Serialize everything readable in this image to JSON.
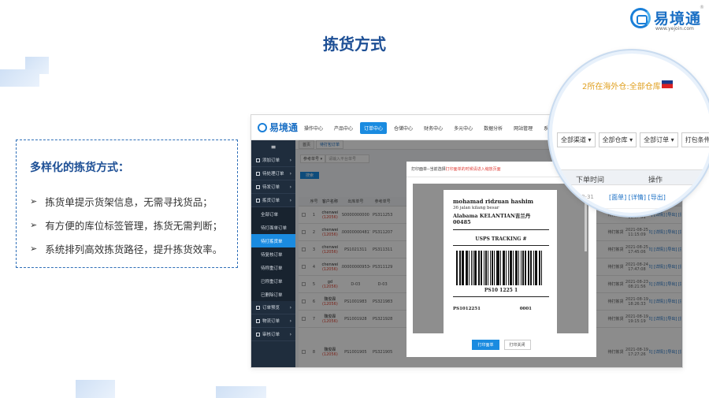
{
  "brand": {
    "name": "易境通",
    "url": "www.yejoin.com",
    "reg": "®"
  },
  "title": "拣货方式",
  "feature": {
    "heading": "多样化的拣货方式：",
    "items": [
      "拣货单提示货架信息，无需寻找货品；",
      "有方便的库位标签管理，拣货无需判断；",
      "系统排列高效拣货路径，提升拣货效率。"
    ],
    "bullet": "➢"
  },
  "app": {
    "logo": "易境通",
    "nav": [
      "操作中心",
      "产品中心",
      "订单中心",
      "仓储中心",
      "财务中心",
      "多元中心",
      "数据分析",
      "网站管理",
      "系统设置"
    ],
    "nav_active_index": 2,
    "sidebar": [
      {
        "label": "≡",
        "kind": "top"
      },
      {
        "label": "添加订单",
        "kind": "group"
      },
      {
        "label": "待处理订单",
        "kind": "group"
      },
      {
        "label": "待发订单",
        "kind": "group"
      },
      {
        "label": "拣货订单",
        "kind": "group"
      },
      {
        "label": "全部订单",
        "kind": "sub"
      },
      {
        "label": "待打面单订单",
        "kind": "sub"
      },
      {
        "label": "待打拣货单",
        "kind": "sub",
        "active": true
      },
      {
        "label": "待复核订单",
        "kind": "sub"
      },
      {
        "label": "待称重订单",
        "kind": "sub"
      },
      {
        "label": "已称重订单",
        "kind": "sub"
      },
      {
        "label": "已删除订单",
        "kind": "sub"
      },
      {
        "label": "订单预览",
        "kind": "group"
      },
      {
        "label": "物流订单",
        "kind": "group"
      },
      {
        "label": "审核订单",
        "kind": "group"
      }
    ],
    "tabs": [
      "首页",
      "待打包订单"
    ],
    "search": {
      "select": "参考单号 ▾",
      "placeholder": "请输入平台单号",
      "button": "搜索"
    },
    "table": {
      "headers": [
        "",
        "序号",
        "客户名称",
        "出库单号",
        "参考单号",
        "",
        "状态",
        "下单时间",
        "操作"
      ],
      "rows": [
        {
          "no": "1",
          "cust": "chenwei",
          "cust_sub": "(12056)",
          "order": "S0000000000",
          "ref": "PS311253",
          "status": "待打拣货",
          "time": "2021-08-25",
          "time2": "11:57:01",
          "actions": "[面单] [详情] [导出] [拆分]"
        },
        {
          "no": "2",
          "cust": "chenwei",
          "cust_sub": "(12056)",
          "order": "1000000004817",
          "ref": "PS311207",
          "status": "待打拣货",
          "time": "2021-08-25",
          "time2": "11:15:09",
          "actions": "[面单] [详情] [导出] [拆分]"
        },
        {
          "no": "3",
          "cust": "chenwei",
          "cust_sub": "(12056)",
          "order": "PS1021311",
          "ref": "PS311311",
          "status": "待打拣货",
          "time": "2021-08-25",
          "time2": "17:45:06",
          "actions": "[面单] [详情] [导出] [拆分]"
        },
        {
          "no": "4",
          "cust": "chenwei",
          "cust_sub": "(12056)",
          "order": "1000000009534",
          "ref": "PS311129",
          "status": "待打拣货",
          "time": "2021-08-24",
          "time2": "17:47:08",
          "actions": "[面单] [详情] [导出] [拆分]"
        },
        {
          "no": "5",
          "cust": "gd",
          "cust_sub": "(12056)",
          "order": "D-03",
          "ref": "D-03",
          "status": "待打拣货",
          "time": "2021-08-23",
          "time2": "08:21:56",
          "actions": "[面单] [详情] [导出] [拆分]"
        },
        {
          "no": "6",
          "cust": "魏俊霖",
          "cust_sub": "(12056)",
          "order": "PS1001983",
          "ref": "PS321983",
          "status": "待打拣货",
          "time": "2021-08-19",
          "time2": "18:26:33",
          "actions": "[面单] [详情] [导出] [拆分]"
        },
        {
          "no": "7",
          "cust": "魏俊霖",
          "cust_sub": "(12056)",
          "order": "PS1001928",
          "ref": "PS321928",
          "status": "待打拣货",
          "time": "2021-08-19",
          "time2": "19:15:19",
          "actions": "[面单] [详情] [导出] [拆分]"
        },
        {
          "no": "8",
          "cust": "魏俊霖",
          "cust_sub": "(12056)",
          "order": "PS1001905",
          "ref": "PS321905",
          "status": "待打拣货",
          "time": "2021-08-19",
          "time2": "17:27:26",
          "actions": "[面单] [详情] [导出] [拆分]"
        }
      ]
    },
    "modal": {
      "header_prefix": "打印面单--当前选择",
      "header_highlight": "打印面单的时候请进入缩放页面",
      "label": {
        "name": "mohamad ridzuan hashim",
        "addr": "36 jalan kilang besar",
        "city": "Alabama KELANTIAN吉兰丹 00485",
        "track_title": "USPS TRACKING #",
        "barcode_text": "PS10 1225 1",
        "bottom_left": "PS1012251",
        "bottom_right": "0001"
      },
      "buttons": {
        "print": "打印面单",
        "cancel": "打印关闭"
      }
    }
  },
  "magnifier": {
    "warehouse": "2所在海外仓:全部仓库",
    "filters": [
      "全部渠道 ▾",
      "全部仓库 ▾",
      "全部订单 ▾",
      "打包条件 ▾"
    ],
    "col_time": "下单时间",
    "col_action": "操作",
    "row_time": "-08-31",
    "row_actions": "[面单] [详情] [导出]"
  }
}
